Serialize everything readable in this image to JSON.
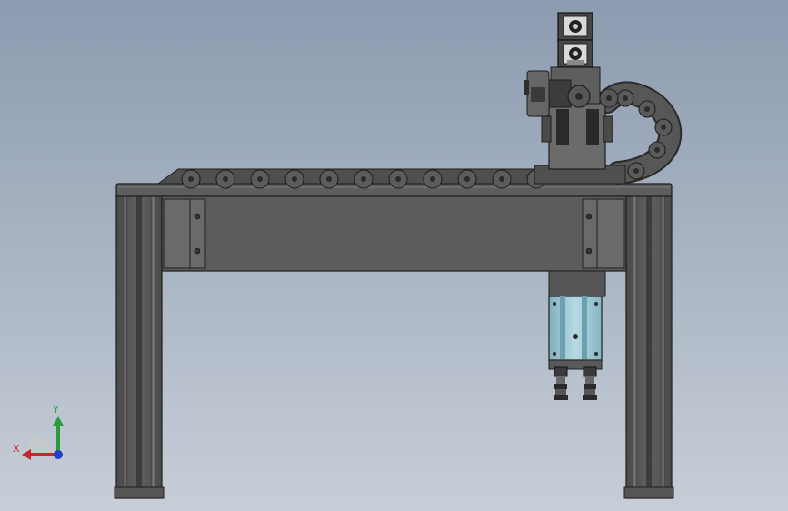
{
  "viewport": {
    "background_top": "#8c9bb0",
    "background_bottom": "#c7ced7"
  },
  "model": {
    "frame_color": "#5a5a5a",
    "frame_dark": "#2e2e2e",
    "cylinder_color": "#9fc7d3"
  },
  "triad": {
    "x_label": "X",
    "y_label": "Y",
    "x_color": "#c8262a",
    "y_color": "#2a9a3a",
    "z_color": "#2140c8"
  }
}
